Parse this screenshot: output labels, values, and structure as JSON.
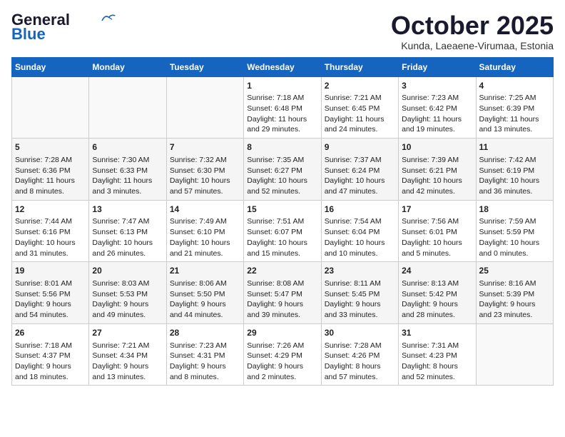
{
  "header": {
    "logo_general": "General",
    "logo_blue": "Blue",
    "month": "October 2025",
    "location": "Kunda, Laeaene-Virumaa, Estonia"
  },
  "days_of_week": [
    "Sunday",
    "Monday",
    "Tuesday",
    "Wednesday",
    "Thursday",
    "Friday",
    "Saturday"
  ],
  "weeks": [
    [
      {
        "day": "",
        "info": ""
      },
      {
        "day": "",
        "info": ""
      },
      {
        "day": "",
        "info": ""
      },
      {
        "day": "1",
        "info": "Sunrise: 7:18 AM\nSunset: 6:48 PM\nDaylight: 11 hours\nand 29 minutes."
      },
      {
        "day": "2",
        "info": "Sunrise: 7:21 AM\nSunset: 6:45 PM\nDaylight: 11 hours\nand 24 minutes."
      },
      {
        "day": "3",
        "info": "Sunrise: 7:23 AM\nSunset: 6:42 PM\nDaylight: 11 hours\nand 19 minutes."
      },
      {
        "day": "4",
        "info": "Sunrise: 7:25 AM\nSunset: 6:39 PM\nDaylight: 11 hours\nand 13 minutes."
      }
    ],
    [
      {
        "day": "5",
        "info": "Sunrise: 7:28 AM\nSunset: 6:36 PM\nDaylight: 11 hours\nand 8 minutes."
      },
      {
        "day": "6",
        "info": "Sunrise: 7:30 AM\nSunset: 6:33 PM\nDaylight: 11 hours\nand 3 minutes."
      },
      {
        "day": "7",
        "info": "Sunrise: 7:32 AM\nSunset: 6:30 PM\nDaylight: 10 hours\nand 57 minutes."
      },
      {
        "day": "8",
        "info": "Sunrise: 7:35 AM\nSunset: 6:27 PM\nDaylight: 10 hours\nand 52 minutes."
      },
      {
        "day": "9",
        "info": "Sunrise: 7:37 AM\nSunset: 6:24 PM\nDaylight: 10 hours\nand 47 minutes."
      },
      {
        "day": "10",
        "info": "Sunrise: 7:39 AM\nSunset: 6:21 PM\nDaylight: 10 hours\nand 42 minutes."
      },
      {
        "day": "11",
        "info": "Sunrise: 7:42 AM\nSunset: 6:19 PM\nDaylight: 10 hours\nand 36 minutes."
      }
    ],
    [
      {
        "day": "12",
        "info": "Sunrise: 7:44 AM\nSunset: 6:16 PM\nDaylight: 10 hours\nand 31 minutes."
      },
      {
        "day": "13",
        "info": "Sunrise: 7:47 AM\nSunset: 6:13 PM\nDaylight: 10 hours\nand 26 minutes."
      },
      {
        "day": "14",
        "info": "Sunrise: 7:49 AM\nSunset: 6:10 PM\nDaylight: 10 hours\nand 21 minutes."
      },
      {
        "day": "15",
        "info": "Sunrise: 7:51 AM\nSunset: 6:07 PM\nDaylight: 10 hours\nand 15 minutes."
      },
      {
        "day": "16",
        "info": "Sunrise: 7:54 AM\nSunset: 6:04 PM\nDaylight: 10 hours\nand 10 minutes."
      },
      {
        "day": "17",
        "info": "Sunrise: 7:56 AM\nSunset: 6:01 PM\nDaylight: 10 hours\nand 5 minutes."
      },
      {
        "day": "18",
        "info": "Sunrise: 7:59 AM\nSunset: 5:59 PM\nDaylight: 10 hours\nand 0 minutes."
      }
    ],
    [
      {
        "day": "19",
        "info": "Sunrise: 8:01 AM\nSunset: 5:56 PM\nDaylight: 9 hours\nand 54 minutes."
      },
      {
        "day": "20",
        "info": "Sunrise: 8:03 AM\nSunset: 5:53 PM\nDaylight: 9 hours\nand 49 minutes."
      },
      {
        "day": "21",
        "info": "Sunrise: 8:06 AM\nSunset: 5:50 PM\nDaylight: 9 hours\nand 44 minutes."
      },
      {
        "day": "22",
        "info": "Sunrise: 8:08 AM\nSunset: 5:47 PM\nDaylight: 9 hours\nand 39 minutes."
      },
      {
        "day": "23",
        "info": "Sunrise: 8:11 AM\nSunset: 5:45 PM\nDaylight: 9 hours\nand 33 minutes."
      },
      {
        "day": "24",
        "info": "Sunrise: 8:13 AM\nSunset: 5:42 PM\nDaylight: 9 hours\nand 28 minutes."
      },
      {
        "day": "25",
        "info": "Sunrise: 8:16 AM\nSunset: 5:39 PM\nDaylight: 9 hours\nand 23 minutes."
      }
    ],
    [
      {
        "day": "26",
        "info": "Sunrise: 7:18 AM\nSunset: 4:37 PM\nDaylight: 9 hours\nand 18 minutes."
      },
      {
        "day": "27",
        "info": "Sunrise: 7:21 AM\nSunset: 4:34 PM\nDaylight: 9 hours\nand 13 minutes."
      },
      {
        "day": "28",
        "info": "Sunrise: 7:23 AM\nSunset: 4:31 PM\nDaylight: 9 hours\nand 8 minutes."
      },
      {
        "day": "29",
        "info": "Sunrise: 7:26 AM\nSunset: 4:29 PM\nDaylight: 9 hours\nand 2 minutes."
      },
      {
        "day": "30",
        "info": "Sunrise: 7:28 AM\nSunset: 4:26 PM\nDaylight: 8 hours\nand 57 minutes."
      },
      {
        "day": "31",
        "info": "Sunrise: 7:31 AM\nSunset: 4:23 PM\nDaylight: 8 hours\nand 52 minutes."
      },
      {
        "day": "",
        "info": ""
      }
    ]
  ]
}
